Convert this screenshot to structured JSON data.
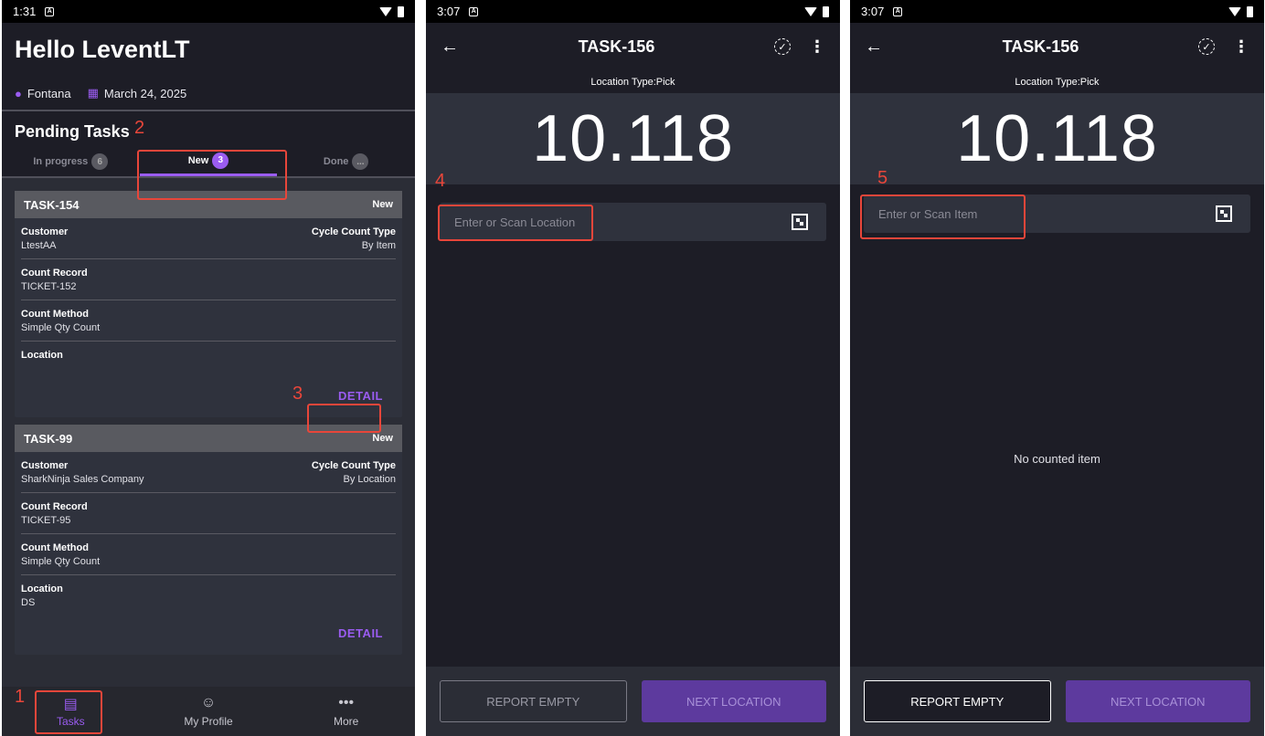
{
  "screen1": {
    "status": {
      "time": "1:31"
    },
    "greeting": "Hello LeventLT",
    "location": "Fontana",
    "date": "March 24, 2025",
    "section_title": "Pending Tasks",
    "tabs": [
      {
        "label": "In progress",
        "count": "6"
      },
      {
        "label": "New",
        "count": "3"
      },
      {
        "label": "Done",
        "count": "..."
      }
    ],
    "tasks": [
      {
        "id": "TASK-154",
        "status": "New",
        "customer_label": "Customer",
        "customer": "LtestAA",
        "cycle_label": "Cycle Count Type",
        "cycle": "By Item",
        "record_label": "Count Record",
        "record": "TICKET-152",
        "method_label": "Count Method",
        "method": "Simple Qty Count",
        "location_label": "Location",
        "location": "",
        "detail": "DETAIL"
      },
      {
        "id": "TASK-99",
        "status": "New",
        "customer_label": "Customer",
        "customer": "SharkNinja Sales Company",
        "cycle_label": "Cycle Count Type",
        "cycle": "By Location",
        "record_label": "Count Record",
        "record": "TICKET-95",
        "method_label": "Count Method",
        "method": "Simple Qty Count",
        "location_label": "Location",
        "location": "DS",
        "detail": "DETAIL"
      }
    ],
    "nav": [
      {
        "label": "Tasks"
      },
      {
        "label": "My Profile"
      },
      {
        "label": "More"
      }
    ]
  },
  "screen2": {
    "status": {
      "time": "3:07"
    },
    "title": "TASK-156",
    "location_type": "Location Type:Pick",
    "big_number": "10.118",
    "scan_placeholder": "Enter or Scan Location",
    "report_empty": "REPORT EMPTY",
    "next_location": "NEXT LOCATION"
  },
  "screen3": {
    "status": {
      "time": "3:07"
    },
    "title": "TASK-156",
    "location_type": "Location Type:Pick",
    "big_number": "10.118",
    "scan_placeholder": "Enter or Scan Item",
    "empty_message": "No counted item",
    "report_empty": "REPORT EMPTY",
    "next_location": "NEXT LOCATION"
  },
  "annotations": [
    "1",
    "2",
    "3",
    "4",
    "5"
  ],
  "colors": {
    "accent": "#9a5cf0",
    "annotation": "#e8463a",
    "background": "#1d1d26"
  }
}
